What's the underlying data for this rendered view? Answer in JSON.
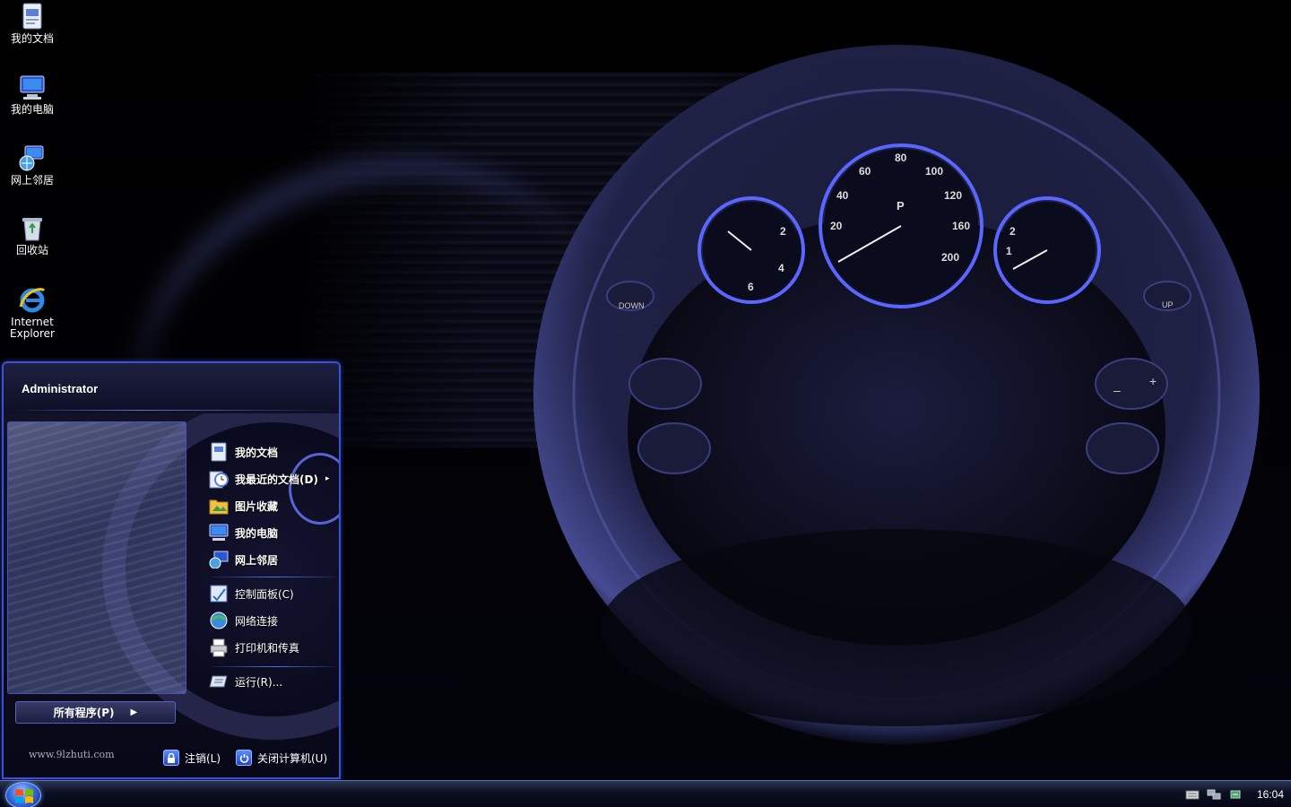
{
  "desktop": {
    "icons": [
      {
        "label": "我的文档"
      },
      {
        "label": "我的电脑"
      },
      {
        "label": "网上邻居"
      },
      {
        "label": "回收站"
      },
      {
        "label": "Internet Explorer"
      }
    ]
  },
  "start_menu": {
    "user_name": "Administrator",
    "items": [
      {
        "label": "我的文档"
      },
      {
        "label": "我最近的文档(D)",
        "arrow": "▸"
      },
      {
        "label": "图片收藏"
      },
      {
        "label": "我的电脑"
      },
      {
        "label": "网上邻居"
      },
      {
        "label": "控制面板(C)"
      },
      {
        "label": "网络连接"
      },
      {
        "label": "打印机和传真"
      },
      {
        "label": "运行(R)..."
      }
    ],
    "all_programs": {
      "label": "所有程序(P)",
      "arrow": "▶"
    },
    "site_url": "www.9lzhuti.com",
    "logoff_label": "注销(L)",
    "shutdown_label": "关闭计算机(U)"
  },
  "taskbar": {
    "clock": "16:04"
  },
  "colors": {
    "accent": "#3b4fd8",
    "taskbar_dark": "#050814",
    "menu_bg": "#0e0f26"
  }
}
